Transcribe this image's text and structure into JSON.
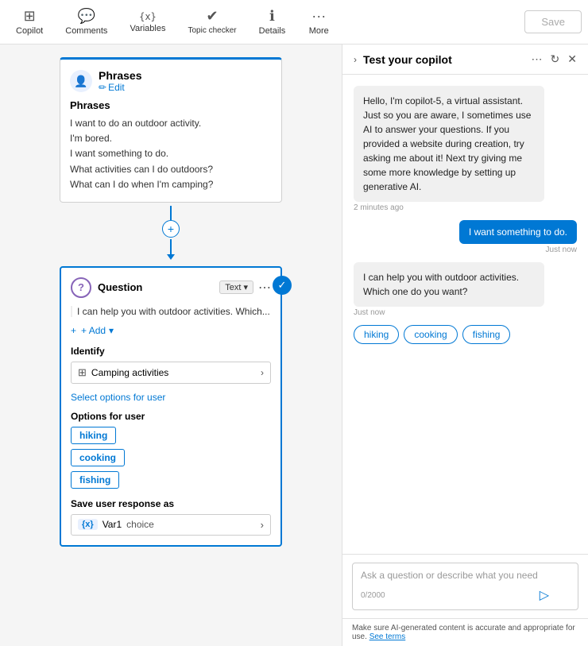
{
  "toolbar": {
    "items": [
      {
        "id": "copilot",
        "icon": "⊞",
        "label": "Copilot"
      },
      {
        "id": "comments",
        "icon": "💬",
        "label": "Comments"
      },
      {
        "id": "variables",
        "icon": "{x}",
        "label": "Variables"
      },
      {
        "id": "topic-checker",
        "icon": "✔",
        "label": "Topic checker"
      },
      {
        "id": "details",
        "icon": "ℹ",
        "label": "Details"
      },
      {
        "id": "more",
        "icon": "···",
        "label": "More"
      }
    ],
    "save_label": "Save"
  },
  "phrases_card": {
    "title": "Phrases",
    "edit_label": "Edit",
    "section_title": "Phrases",
    "phrases": [
      "I want to do an outdoor activity.",
      "I'm bored.",
      "I want something to do.",
      "What activities can I do outdoors?",
      "What can I do when I'm camping?"
    ]
  },
  "question_card": {
    "title": "Question",
    "badge_label": "Text",
    "message": "I can help you with outdoor activities. Which...",
    "add_label": "+ Add",
    "identify_label": "Identify",
    "identify_value": "Camping activities",
    "select_link": "Select options for user",
    "options_label": "Options for user",
    "options": [
      "hiking",
      "cooking",
      "fishing"
    ],
    "save_label": "Save user response as",
    "var_name": "Var1",
    "var_type": "choice"
  },
  "copilot_panel": {
    "title": "Test your copilot",
    "messages": [
      {
        "type": "bot",
        "text": "Hello, I'm copilot-5, a virtual assistant. Just so you are aware, I sometimes use AI to answer your questions. If you provided a website during creation, try asking me about it! Next try giving me some more knowledge by setting up generative AI.",
        "timestamp": "2 minutes ago"
      },
      {
        "type": "user",
        "text": "I want something to do.",
        "timestamp": "Just now"
      },
      {
        "type": "bot",
        "text": "I can help you with outdoor activities. Which one do you want?",
        "timestamp": "Just now"
      }
    ],
    "options": [
      "hiking",
      "cooking",
      "fishing"
    ],
    "input_placeholder": "Ask a question or describe what you need",
    "char_count": "0/2000",
    "disclaimer": "Make sure AI-generated content is accurate and appropriate for use.",
    "see_terms": "See terms"
  }
}
